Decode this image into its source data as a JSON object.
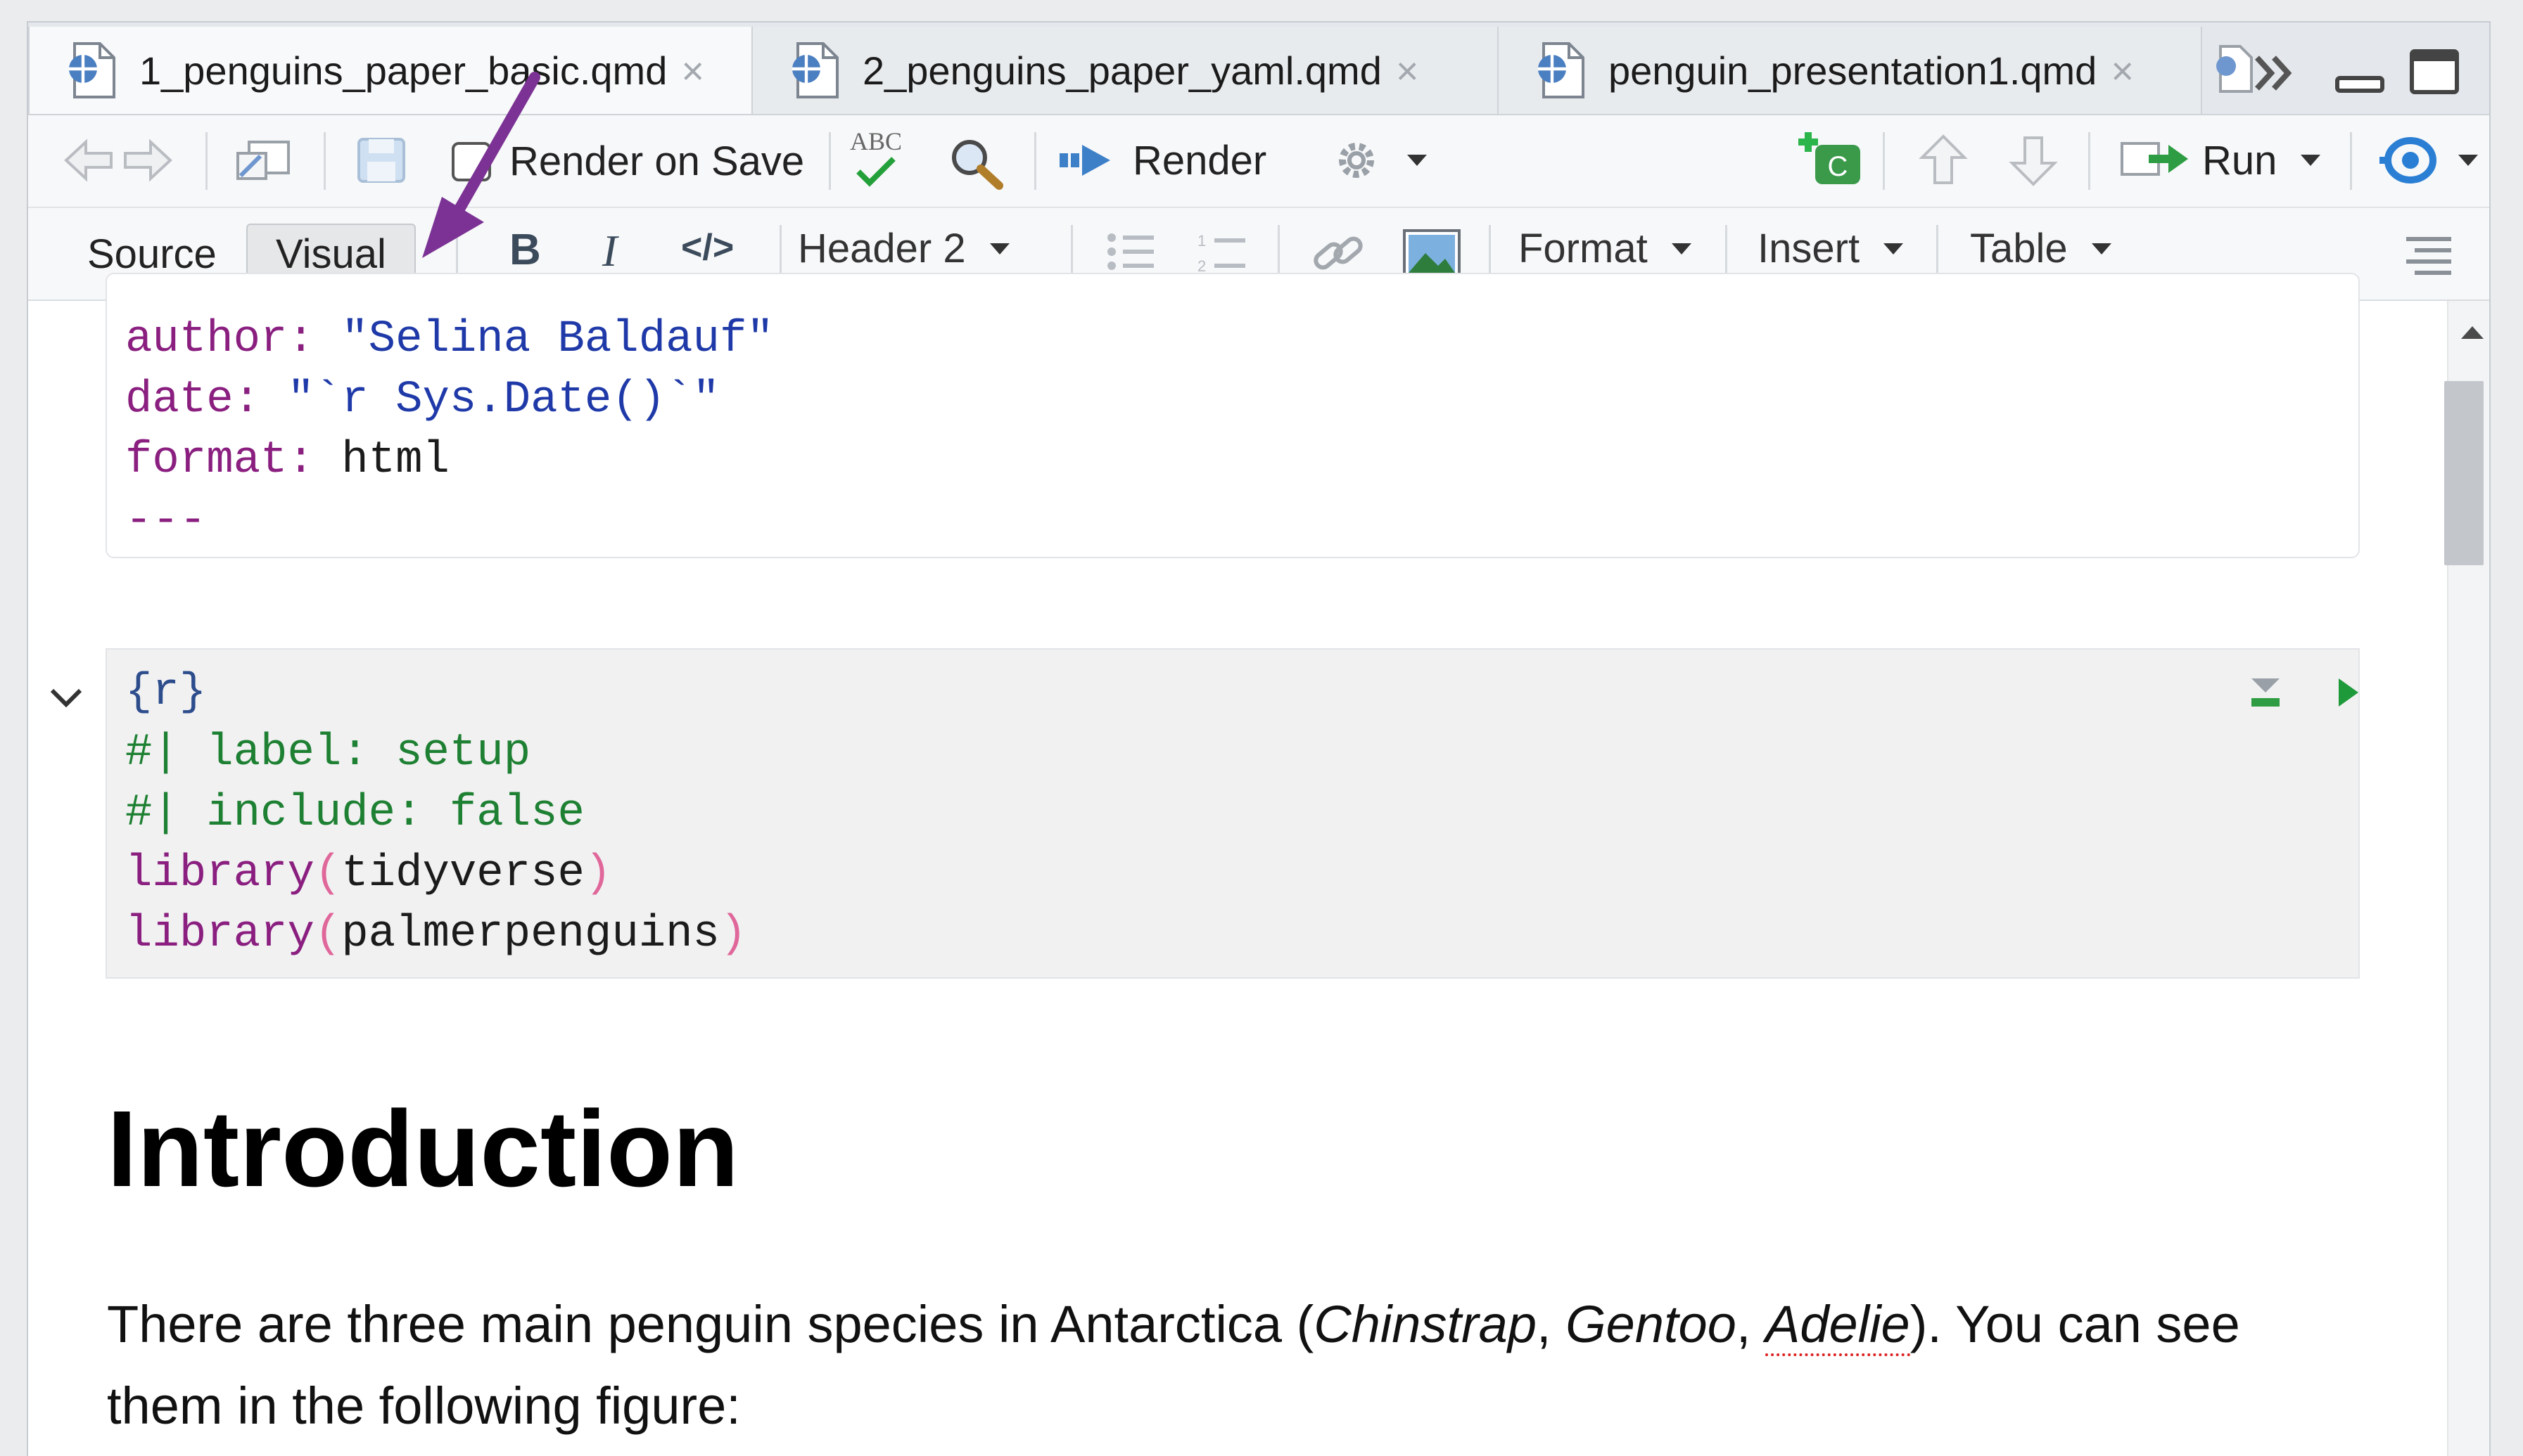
{
  "tabs": [
    {
      "label": "1_penguins_paper_basic.qmd",
      "active": true,
      "close": "×"
    },
    {
      "label": "2_penguins_paper_yaml.qmd",
      "active": false,
      "close": "×"
    },
    {
      "label": "penguin_presentation1.qmd",
      "active": false,
      "close": "×"
    }
  ],
  "toolbar": {
    "render_on_save": "Render on Save",
    "spell_abc": "ABC",
    "render": "Render",
    "run": "Run"
  },
  "visual_toolbar": {
    "source": "Source",
    "visual": "Visual",
    "bold": "B",
    "italic": "I",
    "code": "</>",
    "header": "Header 2",
    "format": "Format",
    "insert": "Insert",
    "table": "Table"
  },
  "yaml": {
    "author_key": "author:",
    "author_val": "\"Selina Baldauf\"",
    "date_key": "date:",
    "date_val": "\"`r Sys.Date()`\"",
    "format_key": "format:",
    "format_val": "html",
    "end": "---"
  },
  "chunk": {
    "header": "{r}",
    "opt_prefix": "#|",
    "opt1": "label: setup",
    "opt2": "include: false",
    "lib_fn": "library",
    "open": "(",
    "close": ")",
    "lib1": "tidyverse",
    "lib2": "palmerpenguins"
  },
  "doc": {
    "heading": "Introduction",
    "para_a": "There are three main penguin species in Antarctica (",
    "sp1": "Chinstrap",
    "comma1": ", ",
    "sp2": "Gentoo",
    "comma2": ", ",
    "sp3": "Adelie",
    "para_b": "). You can see them in the following figure:"
  },
  "colors": {
    "annotation_arrow": "#7b3294",
    "yaml_key": "#8a1f80",
    "yaml_string": "#1f3aa8",
    "comment": "#1e8032"
  }
}
